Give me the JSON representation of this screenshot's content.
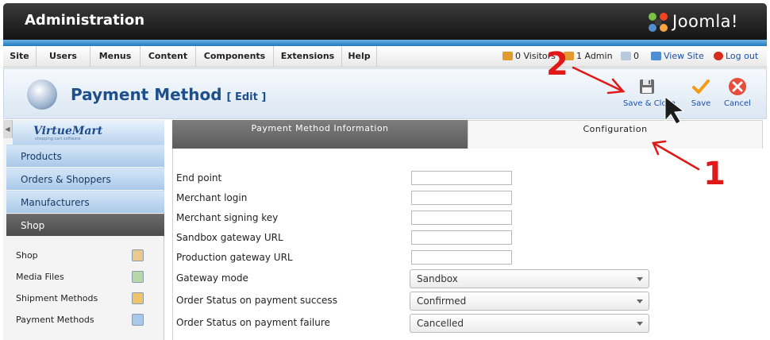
{
  "header": {
    "title": "Administration",
    "brand": "Joomla!"
  },
  "menu": {
    "items": [
      "Site",
      "Users",
      "Menus",
      "Content",
      "Components",
      "Extensions",
      "Help"
    ],
    "visitors": "0 Visitors",
    "admins": "1 Admin",
    "messages": "0",
    "view_site": "View Site",
    "logout": "Log out"
  },
  "toolbar": {
    "title": "Payment Method",
    "title_suffix": "[ Edit ]",
    "save_close": "Save & Close",
    "save": "Save",
    "cancel": "Cancel"
  },
  "sidebar": {
    "logo": "VirtueMart",
    "logo_tagline": "shopping cart software",
    "sections": [
      "Products",
      "Orders & Shoppers",
      "Manufacturers",
      "Shop"
    ],
    "active_section": "Shop",
    "items": [
      "Shop",
      "Media Files",
      "Shipment Methods",
      "Payment Methods"
    ]
  },
  "tabs": {
    "info": "Payment Method Information",
    "config": "Configuration",
    "active": "config"
  },
  "form": {
    "labels": [
      "End point",
      "Merchant login",
      "Merchant signing key",
      "Sandbox gateway URL",
      "Production gateway URL"
    ],
    "values": [
      "",
      "",
      "",
      "",
      ""
    ],
    "gateway_mode_label": "Gateway mode",
    "gateway_mode_value": "Sandbox",
    "success_label": "Order Status on payment success",
    "success_value": "Confirmed",
    "failure_label": "Order Status on payment failure",
    "failure_value": "Cancelled"
  },
  "annotations": {
    "step1": "1",
    "step2": "2",
    "color": "#e01818"
  },
  "colors": {
    "accent": "#1d4f8c",
    "header_stripe": "#1f78c1",
    "annotation": "#e01818"
  }
}
